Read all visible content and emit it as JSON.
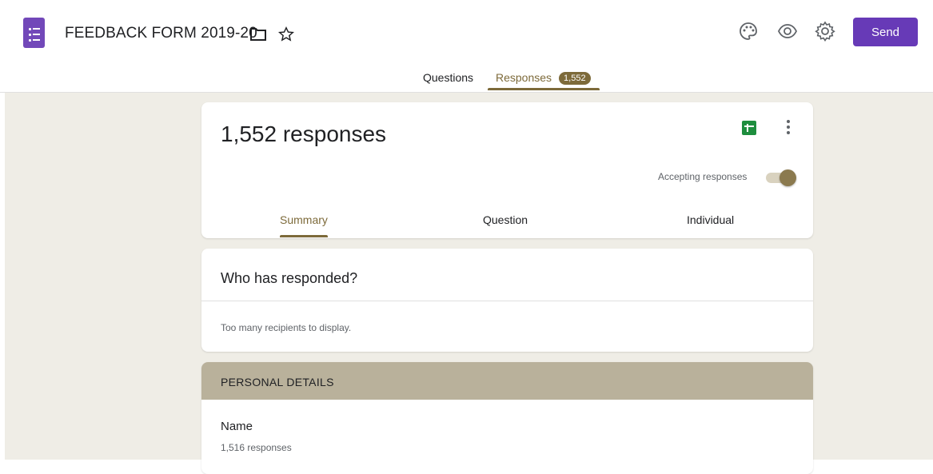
{
  "header": {
    "title": "FEEDBACK FORM 2019-20",
    "send_label": "Send",
    "icons": [
      "forms-logo-icon",
      "folder-icon",
      "star-icon",
      "palette-icon",
      "preview-eye-icon",
      "settings-gear-icon"
    ]
  },
  "tabs": {
    "questions": "Questions",
    "responses": "Responses",
    "responses_count": "1,552"
  },
  "summary_card": {
    "response_count": "1,552 responses",
    "accepting_label": "Accepting responses",
    "accepting_on": true,
    "subtabs": [
      "Summary",
      "Question",
      "Individual"
    ]
  },
  "who_card": {
    "title": "Who has responded?",
    "note": "Too many recipients to display."
  },
  "section": {
    "title": "PERSONAL DETAILS",
    "question": "Name",
    "question_count": "1,516 responses"
  },
  "colors": {
    "brand": "#673ab7",
    "accent": "#7d6a3a",
    "background": "#efede6",
    "section_header": "#b9b19b"
  }
}
